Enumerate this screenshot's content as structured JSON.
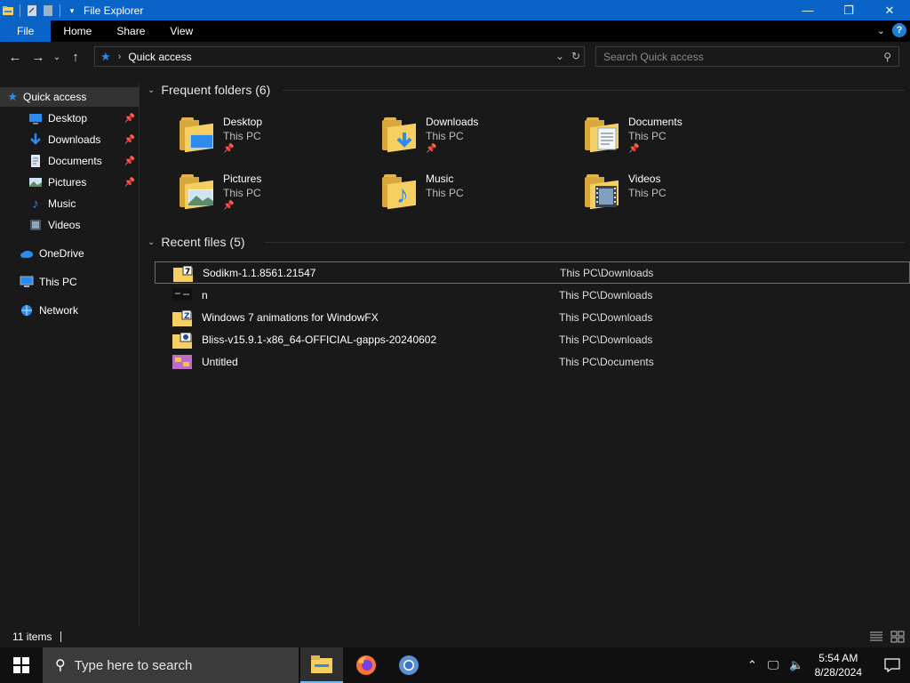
{
  "window": {
    "title": "File Explorer",
    "controls": {
      "minimize": "—",
      "maximize": "❐",
      "close": "✕"
    }
  },
  "ribbon": {
    "tabs": [
      {
        "label": "File"
      },
      {
        "label": "Home"
      },
      {
        "label": "Share"
      },
      {
        "label": "View"
      }
    ],
    "help": "?"
  },
  "address": {
    "crumb": "Quick access",
    "search_placeholder": "Search Quick access"
  },
  "nav_pane": {
    "items": [
      {
        "label": "Quick access",
        "icon": "star-icon",
        "pinned": false
      },
      {
        "label": "Desktop",
        "icon": "desktop-icon",
        "pinned": true
      },
      {
        "label": "Downloads",
        "icon": "downloads-icon",
        "pinned": true
      },
      {
        "label": "Documents",
        "icon": "documents-icon",
        "pinned": true
      },
      {
        "label": "Pictures",
        "icon": "pictures-icon",
        "pinned": true
      },
      {
        "label": "Music",
        "icon": "music-icon",
        "pinned": false
      },
      {
        "label": "Videos",
        "icon": "videos-icon",
        "pinned": false
      },
      {
        "label": "OneDrive",
        "icon": "onedrive-icon",
        "pinned": false
      },
      {
        "label": "This PC",
        "icon": "this-pc-icon",
        "pinned": false
      },
      {
        "label": "Network",
        "icon": "network-icon",
        "pinned": false
      }
    ]
  },
  "frequent_folders": {
    "header": "Frequent folders (6)",
    "items": [
      {
        "name": "Desktop",
        "location": "This PC",
        "pinned": true,
        "icon": "desktop-folder-icon"
      },
      {
        "name": "Downloads",
        "location": "This PC",
        "pinned": true,
        "icon": "downloads-folder-icon"
      },
      {
        "name": "Documents",
        "location": "This PC",
        "pinned": true,
        "icon": "documents-folder-icon"
      },
      {
        "name": "Pictures",
        "location": "This PC",
        "pinned": true,
        "icon": "pictures-folder-icon"
      },
      {
        "name": "Music",
        "location": "This PC",
        "pinned": false,
        "icon": "music-folder-icon"
      },
      {
        "name": "Videos",
        "location": "This PC",
        "pinned": false,
        "icon": "videos-folder-icon"
      }
    ]
  },
  "recent_files": {
    "header": "Recent files (5)",
    "items": [
      {
        "name": "Sodikm-1.1.8561.21547",
        "location": "This PC\\Downloads",
        "icon": "7z-archive-icon",
        "selected": true
      },
      {
        "name": "n",
        "location": "This PC\\Downloads",
        "icon": "image-file-icon",
        "selected": false
      },
      {
        "name": "Windows 7 animations for WindowFX",
        "location": "This PC\\Downloads",
        "icon": "zip-archive-icon",
        "selected": false
      },
      {
        "name": "Bliss-v15.9.1-x86_64-OFFICIAL-gapps-20240602",
        "location": "This PC\\Downloads",
        "icon": "iso-archive-icon",
        "selected": false
      },
      {
        "name": "Untitled",
        "location": "This PC\\Documents",
        "icon": "paint-file-icon",
        "selected": false
      }
    ]
  },
  "status": {
    "count": "11 items"
  },
  "taskbar": {
    "search_placeholder": "Type here to search",
    "time": "5:54 AM",
    "date": "8/28/2024"
  },
  "colors": {
    "accent": "#0a64c8",
    "folder": "#f6cf63",
    "background": "#191919"
  }
}
